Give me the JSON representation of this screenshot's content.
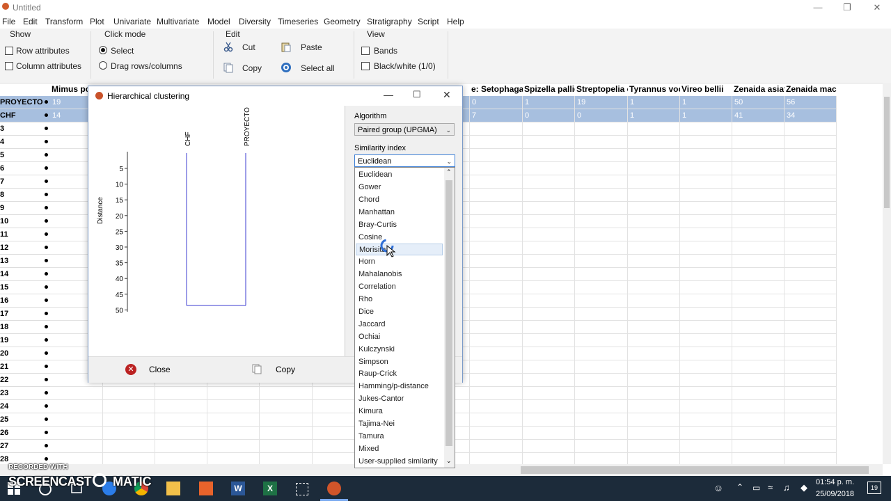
{
  "window": {
    "title": "Untitled"
  },
  "menu": [
    "File",
    "Edit",
    "Transform",
    "Plot",
    "Univariate",
    "Multivariate",
    "Model",
    "Diversity",
    "Timeseries",
    "Geometry",
    "Stratigraphy",
    "Script",
    "Help"
  ],
  "toolbar": {
    "show": {
      "title": "Show",
      "row_attributes": "Row attributes",
      "column_attributes": "Column attributes"
    },
    "click_mode": {
      "title": "Click mode",
      "select": "Select",
      "drag": "Drag rows/columns"
    },
    "edit": {
      "title": "Edit",
      "cut": "Cut",
      "paste": "Paste",
      "copy": "Copy",
      "select_all": "Select all"
    },
    "view": {
      "title": "View",
      "bands": "Bands",
      "bw": "Black/white (1/0)"
    }
  },
  "grid": {
    "columns": [
      "Mimus po",
      "",
      "",
      "",
      "",
      "",
      "",
      "",
      "e: Setophaga co",
      "Spizella pallid",
      "Streptopelia c",
      "Tyrannus voc",
      "Vireo bellii",
      "Zenaida asiat",
      "Zenaida macr"
    ],
    "rows": [
      "PROYECTO",
      "CHF",
      "3",
      "4",
      "5",
      "6",
      "7",
      "8",
      "9",
      "10",
      "11",
      "12",
      "13",
      "14",
      "15",
      "16",
      "17",
      "18",
      "19",
      "20",
      "21",
      "22",
      "23",
      "24",
      "25",
      "26",
      "27",
      "28"
    ],
    "row_values": [
      [
        "19",
        "",
        "",
        "",
        "",
        "",
        "",
        "",
        "0",
        "1",
        "19",
        "1",
        "1",
        "50",
        "56"
      ],
      [
        "14",
        "",
        "",
        "",
        "",
        "",
        "",
        "",
        "7",
        "0",
        "0",
        "1",
        "1",
        "41",
        "34"
      ]
    ]
  },
  "dialog": {
    "title": "Hierarchical clustering",
    "algorithm_label": "Algorithm",
    "algorithm_value": "Paired group (UPGMA)",
    "similarity_label": "Similarity index",
    "similarity_value": "Euclidean",
    "close_label": "Close",
    "copy_label": "Copy",
    "leaf_labels": [
      "CHF",
      "PROYECTO"
    ],
    "axis_label": "Distance",
    "ticks": [
      "5",
      "10",
      "15",
      "20",
      "25",
      "30",
      "35",
      "40",
      "45",
      "50"
    ]
  },
  "similarity_options": [
    "Euclidean",
    "Gower",
    "Chord",
    "Manhattan",
    "Bray-Curtis",
    "Cosine",
    "Morisita",
    "Horn",
    "Mahalanobis",
    "Correlation",
    "Rho",
    "Dice",
    "Jaccard",
    "Ochiai",
    "Kulczynski",
    "Simpson",
    "Raup-Crick",
    "Hamming/p-distance",
    "Jukes-Cantor",
    "Kimura",
    "Tajima-Nei",
    "Tamura",
    "Mixed",
    "User-supplied similarity"
  ],
  "highlighted_option": "Morisita",
  "watermark": {
    "line1": "RECORDED WITH",
    "line2": "SCREENCAST",
    "line3": "MATIC"
  },
  "clock": {
    "time": "01:54 p. m.",
    "date": "25/09/2018",
    "notifications": "19"
  },
  "colors": {
    "selection": "#a7bfdf",
    "dendrogram": "#3b3bd0",
    "taskbar": "#1c2b3a"
  }
}
